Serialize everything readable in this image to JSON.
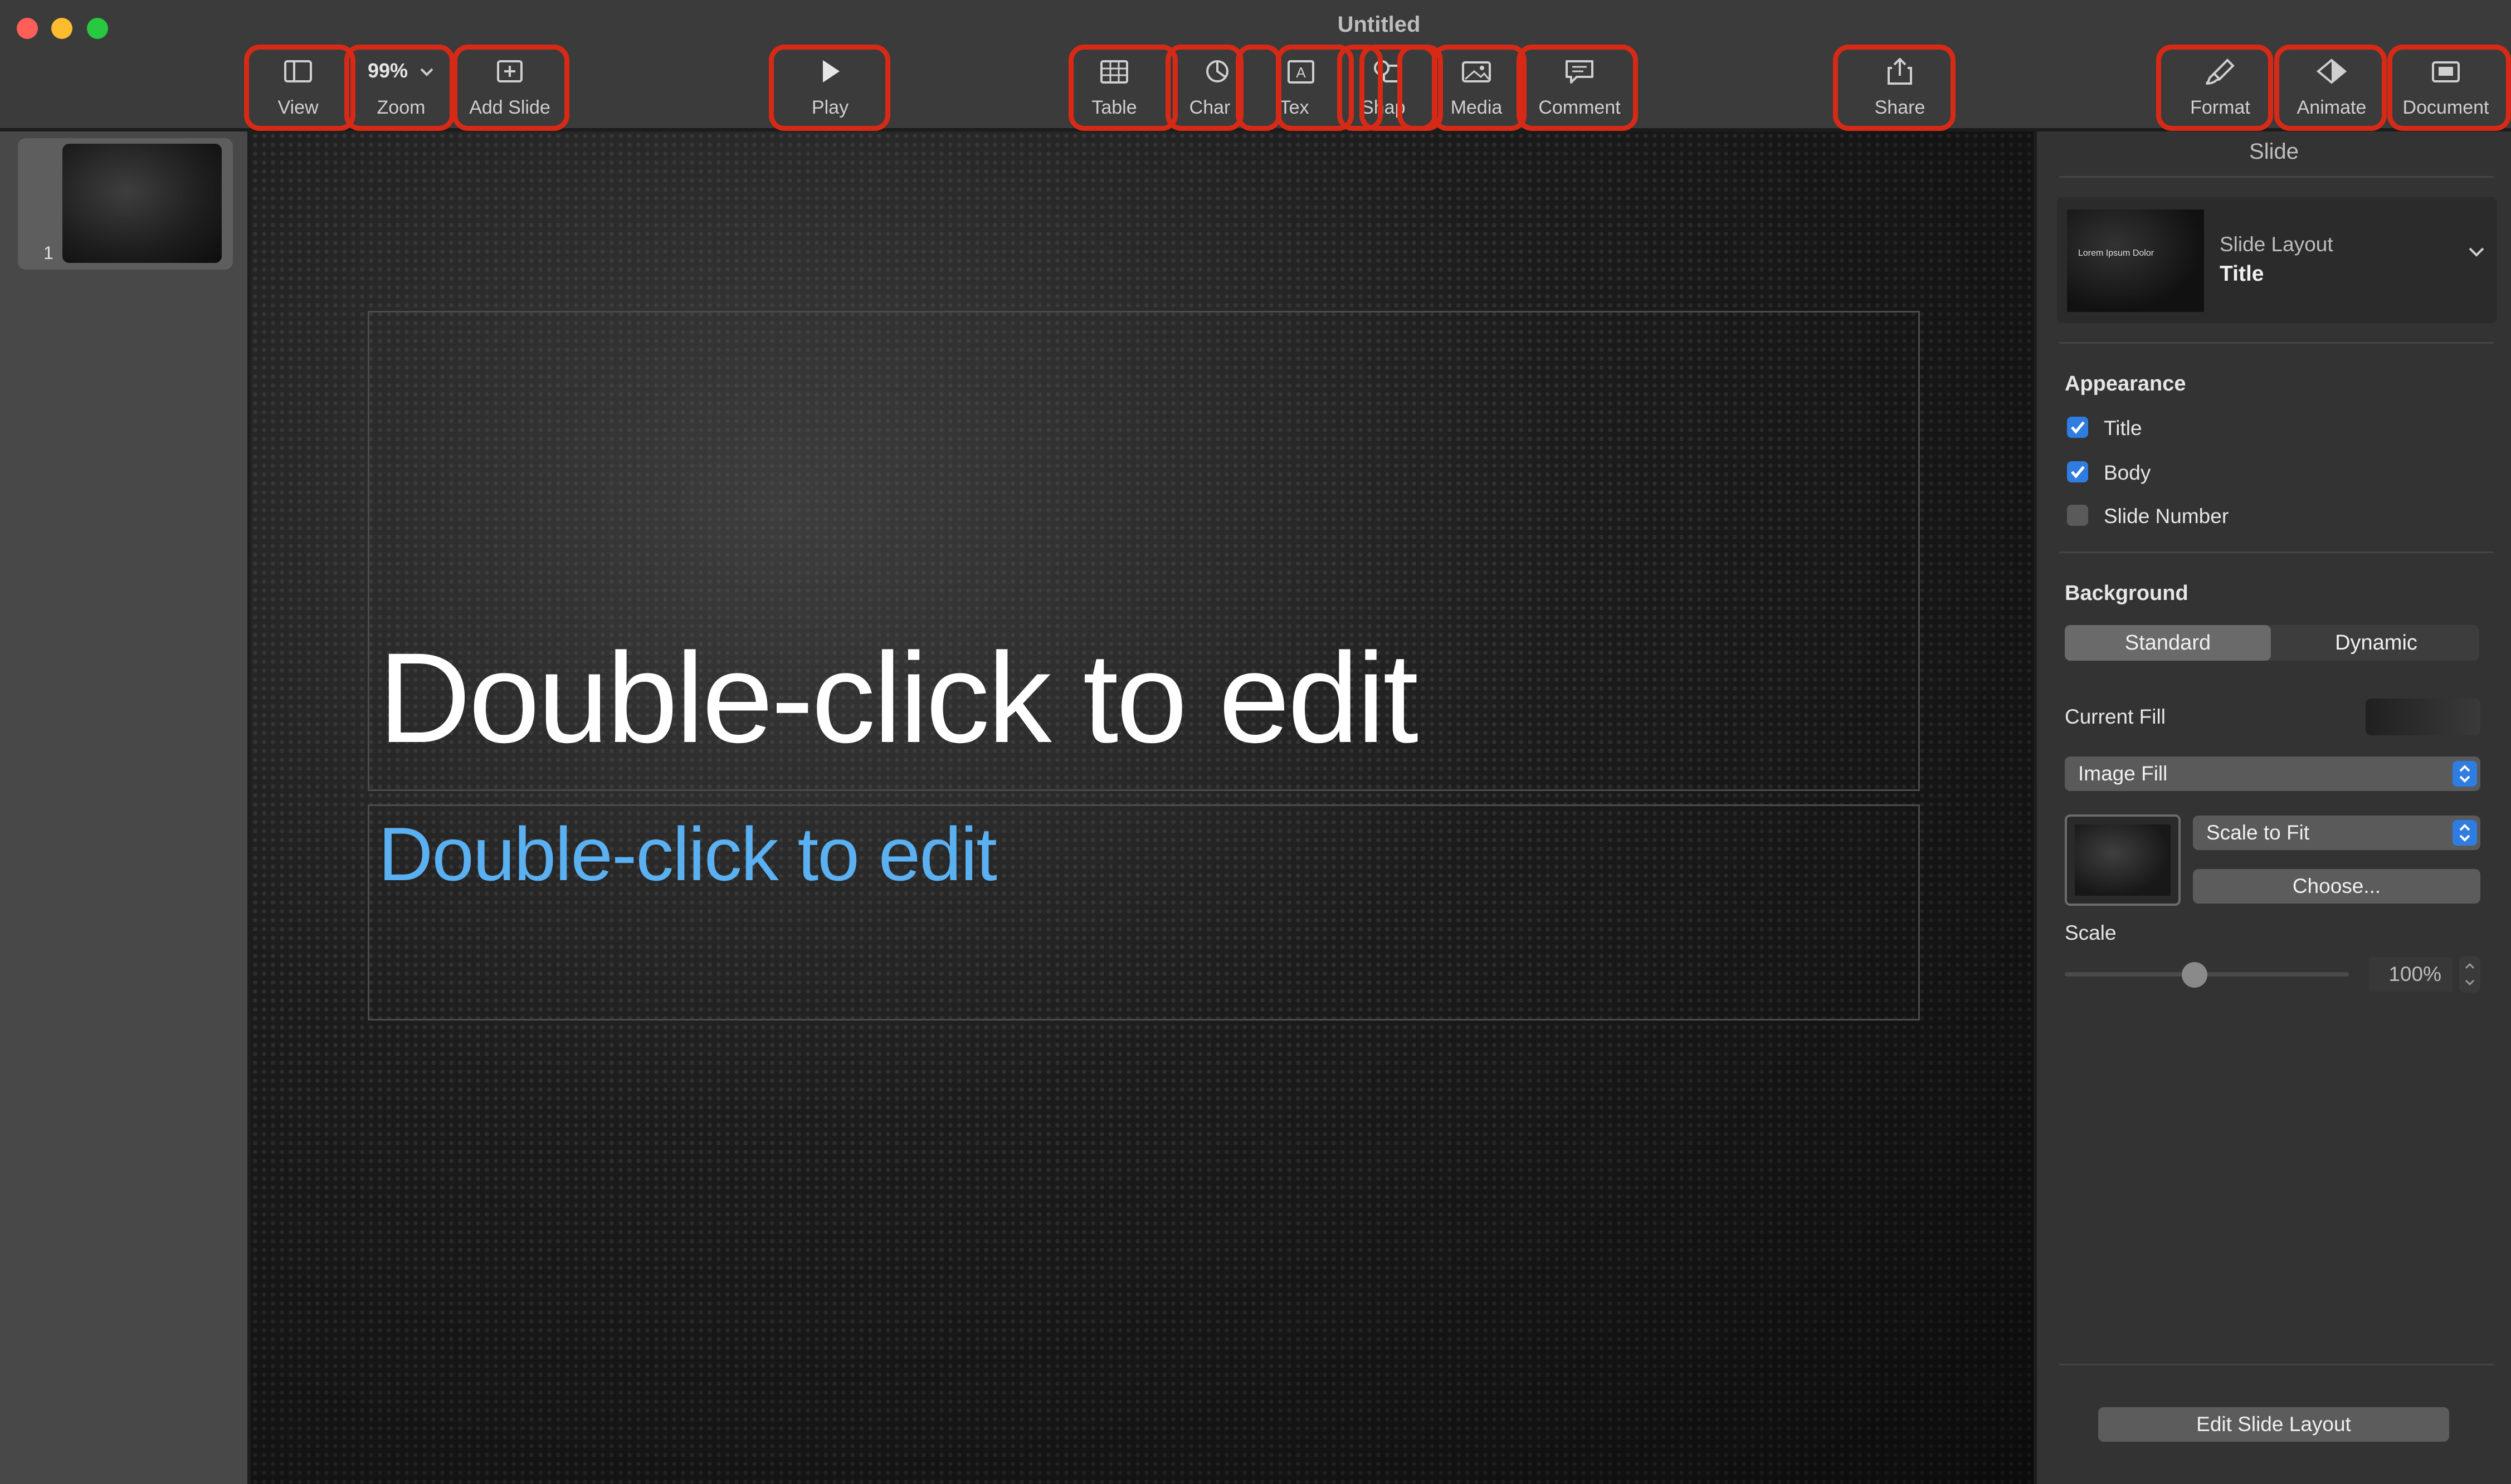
{
  "window": {
    "title": "Untitled"
  },
  "toolbar": {
    "view": "View",
    "zoom_value": "99%",
    "zoom": "Zoom",
    "add_slide": "Add Slide",
    "play": "Play",
    "table": "Table",
    "chart": "Char",
    "text": "Tex",
    "shape": "Shap",
    "media": "Media",
    "comment": "Comment",
    "share": "Share",
    "format": "Format",
    "animate": "Animate",
    "document": "Document"
  },
  "navigator": {
    "slides": [
      {
        "number": "1"
      }
    ]
  },
  "canvas": {
    "title_placeholder": "Double-click to edit",
    "body_placeholder": "Double-click to edit"
  },
  "inspector": {
    "header": "Slide",
    "layout": {
      "thumb_text": "Lorem Ipsum Dolor",
      "label": "Slide Layout",
      "value": "Title"
    },
    "appearance": {
      "title": "Appearance",
      "items": [
        {
          "label": "Title",
          "checked": true
        },
        {
          "label": "Body",
          "checked": true
        },
        {
          "label": "Slide Number",
          "checked": false
        }
      ]
    },
    "background": {
      "title": "Background",
      "standard": "Standard",
      "dynamic": "Dynamic",
      "selected": "Standard"
    },
    "current_fill": "Current Fill",
    "fill_type": "Image Fill",
    "scale_mode": "Scale to Fit",
    "choose": "Choose...",
    "scale_label": "Scale",
    "scale_value": "100%",
    "edit_layout": "Edit Slide Layout"
  },
  "colors": {
    "highlight": "#d62a16",
    "accent": "#2f7de1",
    "body_placeholder": "#5ab0f0"
  }
}
